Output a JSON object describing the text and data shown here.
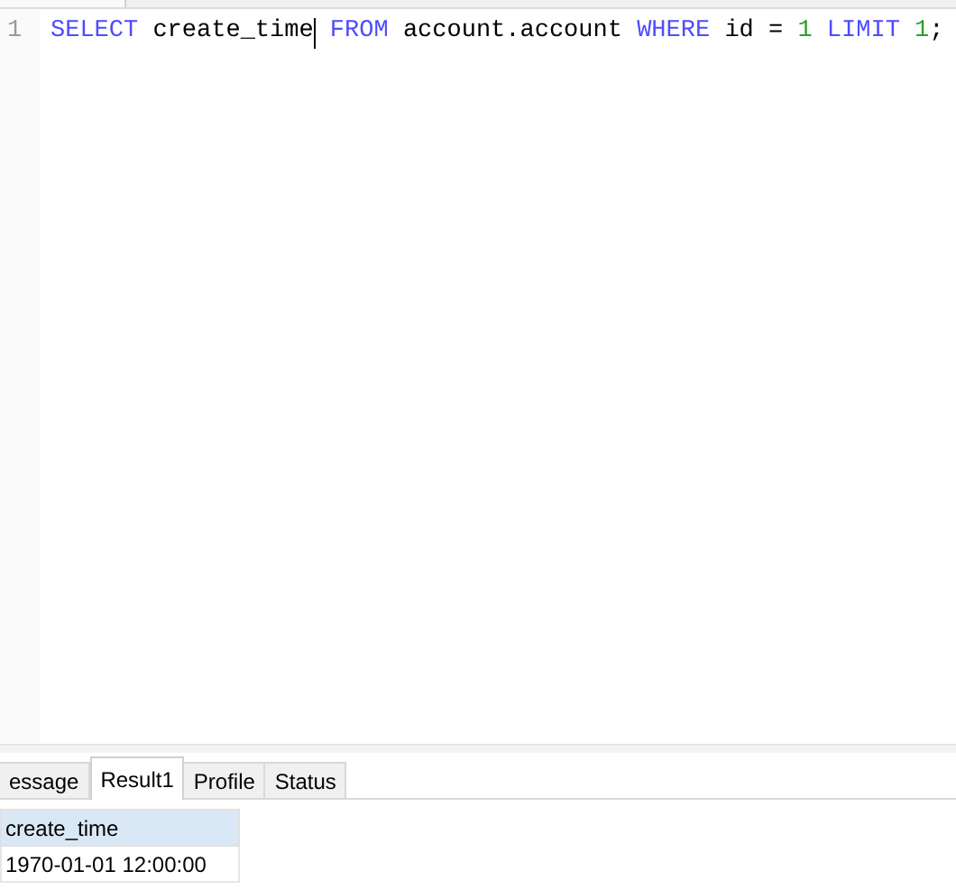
{
  "editor": {
    "lines": [
      {
        "number": "1",
        "tokens": [
          {
            "kind": "keyword",
            "text": "SELECT"
          },
          {
            "kind": "plain",
            "text": " create_time"
          },
          {
            "kind": "cursor"
          },
          {
            "kind": "keyword",
            "text": " FROM"
          },
          {
            "kind": "plain",
            "text": " account.account "
          },
          {
            "kind": "keyword",
            "text": "WHERE"
          },
          {
            "kind": "plain",
            "text": " id = "
          },
          {
            "kind": "number",
            "text": "1"
          },
          {
            "kind": "keyword",
            "text": " LIMIT"
          },
          {
            "kind": "number",
            "text": " 1"
          },
          {
            "kind": "plain",
            "text": ";"
          }
        ]
      }
    ]
  },
  "result_tabs": [
    {
      "label": "essage",
      "selected": false
    },
    {
      "label": "Result1",
      "selected": true
    },
    {
      "label": "Profile",
      "selected": false
    },
    {
      "label": "Status",
      "selected": false
    }
  ],
  "result_grid": {
    "columns": [
      "create_time"
    ],
    "rows": [
      [
        "1970-01-01 12:00:00"
      ]
    ]
  }
}
